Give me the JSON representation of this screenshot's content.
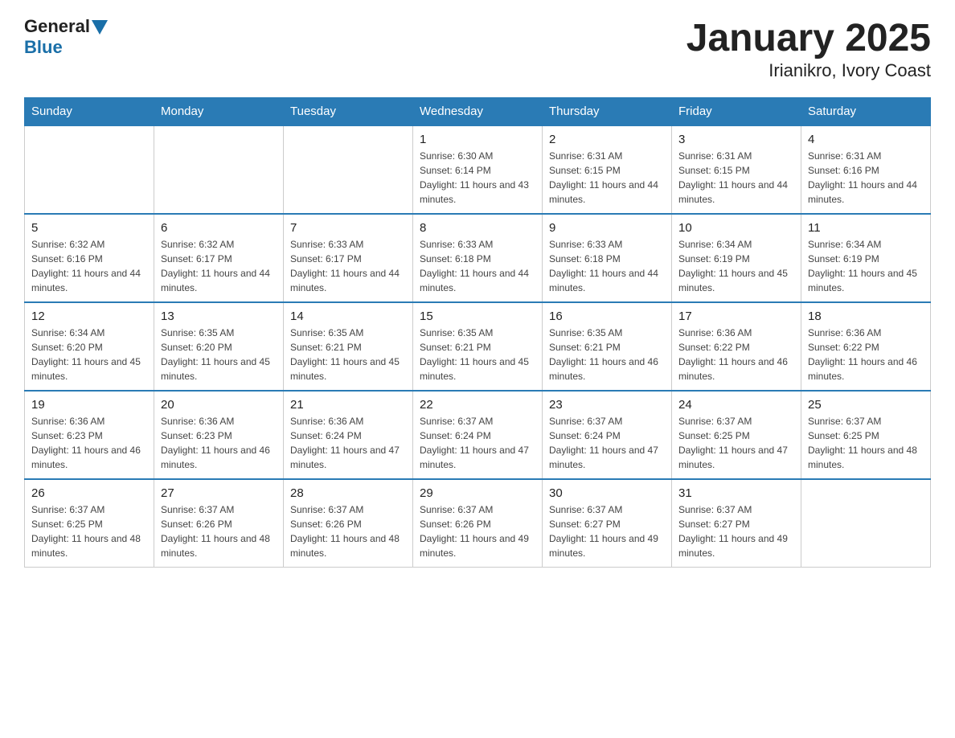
{
  "header": {
    "logo_general": "General",
    "logo_blue": "Blue",
    "title": "January 2025",
    "subtitle": "Irianikro, Ivory Coast"
  },
  "days_of_week": [
    "Sunday",
    "Monday",
    "Tuesday",
    "Wednesday",
    "Thursday",
    "Friday",
    "Saturday"
  ],
  "weeks": [
    {
      "days": [
        {
          "num": "",
          "info": ""
        },
        {
          "num": "",
          "info": ""
        },
        {
          "num": "",
          "info": ""
        },
        {
          "num": "1",
          "info": "Sunrise: 6:30 AM\nSunset: 6:14 PM\nDaylight: 11 hours and 43 minutes."
        },
        {
          "num": "2",
          "info": "Sunrise: 6:31 AM\nSunset: 6:15 PM\nDaylight: 11 hours and 44 minutes."
        },
        {
          "num": "3",
          "info": "Sunrise: 6:31 AM\nSunset: 6:15 PM\nDaylight: 11 hours and 44 minutes."
        },
        {
          "num": "4",
          "info": "Sunrise: 6:31 AM\nSunset: 6:16 PM\nDaylight: 11 hours and 44 minutes."
        }
      ]
    },
    {
      "days": [
        {
          "num": "5",
          "info": "Sunrise: 6:32 AM\nSunset: 6:16 PM\nDaylight: 11 hours and 44 minutes."
        },
        {
          "num": "6",
          "info": "Sunrise: 6:32 AM\nSunset: 6:17 PM\nDaylight: 11 hours and 44 minutes."
        },
        {
          "num": "7",
          "info": "Sunrise: 6:33 AM\nSunset: 6:17 PM\nDaylight: 11 hours and 44 minutes."
        },
        {
          "num": "8",
          "info": "Sunrise: 6:33 AM\nSunset: 6:18 PM\nDaylight: 11 hours and 44 minutes."
        },
        {
          "num": "9",
          "info": "Sunrise: 6:33 AM\nSunset: 6:18 PM\nDaylight: 11 hours and 44 minutes."
        },
        {
          "num": "10",
          "info": "Sunrise: 6:34 AM\nSunset: 6:19 PM\nDaylight: 11 hours and 45 minutes."
        },
        {
          "num": "11",
          "info": "Sunrise: 6:34 AM\nSunset: 6:19 PM\nDaylight: 11 hours and 45 minutes."
        }
      ]
    },
    {
      "days": [
        {
          "num": "12",
          "info": "Sunrise: 6:34 AM\nSunset: 6:20 PM\nDaylight: 11 hours and 45 minutes."
        },
        {
          "num": "13",
          "info": "Sunrise: 6:35 AM\nSunset: 6:20 PM\nDaylight: 11 hours and 45 minutes."
        },
        {
          "num": "14",
          "info": "Sunrise: 6:35 AM\nSunset: 6:21 PM\nDaylight: 11 hours and 45 minutes."
        },
        {
          "num": "15",
          "info": "Sunrise: 6:35 AM\nSunset: 6:21 PM\nDaylight: 11 hours and 45 minutes."
        },
        {
          "num": "16",
          "info": "Sunrise: 6:35 AM\nSunset: 6:21 PM\nDaylight: 11 hours and 46 minutes."
        },
        {
          "num": "17",
          "info": "Sunrise: 6:36 AM\nSunset: 6:22 PM\nDaylight: 11 hours and 46 minutes."
        },
        {
          "num": "18",
          "info": "Sunrise: 6:36 AM\nSunset: 6:22 PM\nDaylight: 11 hours and 46 minutes."
        }
      ]
    },
    {
      "days": [
        {
          "num": "19",
          "info": "Sunrise: 6:36 AM\nSunset: 6:23 PM\nDaylight: 11 hours and 46 minutes."
        },
        {
          "num": "20",
          "info": "Sunrise: 6:36 AM\nSunset: 6:23 PM\nDaylight: 11 hours and 46 minutes."
        },
        {
          "num": "21",
          "info": "Sunrise: 6:36 AM\nSunset: 6:24 PM\nDaylight: 11 hours and 47 minutes."
        },
        {
          "num": "22",
          "info": "Sunrise: 6:37 AM\nSunset: 6:24 PM\nDaylight: 11 hours and 47 minutes."
        },
        {
          "num": "23",
          "info": "Sunrise: 6:37 AM\nSunset: 6:24 PM\nDaylight: 11 hours and 47 minutes."
        },
        {
          "num": "24",
          "info": "Sunrise: 6:37 AM\nSunset: 6:25 PM\nDaylight: 11 hours and 47 minutes."
        },
        {
          "num": "25",
          "info": "Sunrise: 6:37 AM\nSunset: 6:25 PM\nDaylight: 11 hours and 48 minutes."
        }
      ]
    },
    {
      "days": [
        {
          "num": "26",
          "info": "Sunrise: 6:37 AM\nSunset: 6:25 PM\nDaylight: 11 hours and 48 minutes."
        },
        {
          "num": "27",
          "info": "Sunrise: 6:37 AM\nSunset: 6:26 PM\nDaylight: 11 hours and 48 minutes."
        },
        {
          "num": "28",
          "info": "Sunrise: 6:37 AM\nSunset: 6:26 PM\nDaylight: 11 hours and 48 minutes."
        },
        {
          "num": "29",
          "info": "Sunrise: 6:37 AM\nSunset: 6:26 PM\nDaylight: 11 hours and 49 minutes."
        },
        {
          "num": "30",
          "info": "Sunrise: 6:37 AM\nSunset: 6:27 PM\nDaylight: 11 hours and 49 minutes."
        },
        {
          "num": "31",
          "info": "Sunrise: 6:37 AM\nSunset: 6:27 PM\nDaylight: 11 hours and 49 minutes."
        },
        {
          "num": "",
          "info": ""
        }
      ]
    }
  ]
}
